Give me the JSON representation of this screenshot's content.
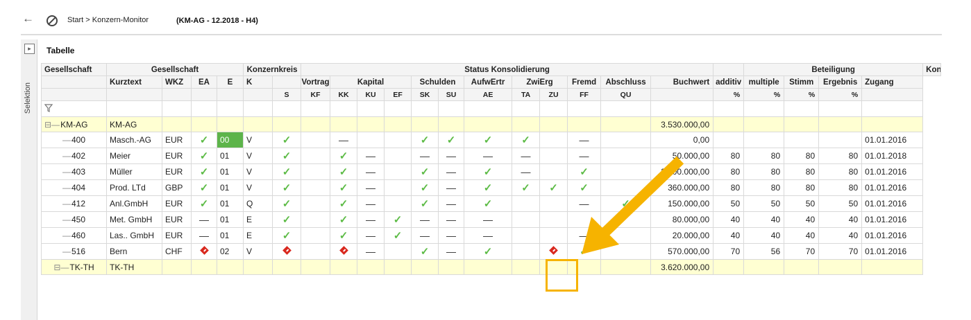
{
  "nav": {
    "breadcrumb": "Start > Konzern-Monitor",
    "context": "(KM-AG - 12.2018 - H4)",
    "back_icon": "arrow-left-icon",
    "block_icon": "no-entry-icon"
  },
  "sidebar": {
    "label": "Selektion",
    "toggle_icon": "expand-right-icon"
  },
  "grid": {
    "title": "Tabelle",
    "header1": {
      "gesellschaft": "Gesellschaft",
      "gesellschaft2": "Gesellschaft",
      "konzernkreis": "Konzernkreis",
      "status": "Status Konsolidierung",
      "beteiligung": "Beteiligung",
      "konzernkreis2": "Konzernkreis"
    },
    "header2": {
      "kurztext": "Kurztext",
      "wkz": "WKZ",
      "ea": "EA",
      "e": "E",
      "k": "K",
      "vortrag": "Vortrag",
      "kapital": "Kapital",
      "schulden": "Schulden",
      "aufwertr": "AufwErtr",
      "zwierg": "ZwiErg",
      "fremd": "Fremd",
      "abschluss": "Abschluss",
      "buchwert": "Buchwert",
      "additiv": "additiv",
      "multiple": "multiple",
      "stimm": "Stimm",
      "ergebnis": "Ergebnis",
      "zugang": "Zugang"
    },
    "header3": {
      "s": "S",
      "kf": "KF",
      "kk": "KK",
      "ku": "KU",
      "ef": "EF",
      "sk": "SK",
      "su": "SU",
      "ae": "AE",
      "ta": "TA",
      "zu": "ZU",
      "ff": "FF",
      "qu": "QU",
      "p1": "%",
      "p2": "%",
      "p3": "%",
      "p4": "%"
    },
    "filter_icon": "filter-icon",
    "groups": [
      {
        "name": "KM-AG",
        "kurztext": "KM-AG",
        "buchwert": "3.530.000,00"
      },
      {
        "name": "TK-TH",
        "kurztext": "TK-TH",
        "buchwert": "3.620.000,00"
      }
    ],
    "rows": [
      {
        "id": "400",
        "kurz": "Masch.-AG",
        "wkz": "EUR",
        "ea": "check",
        "e": "00",
        "k": "V",
        "s": "check",
        "kf": "",
        "kk": "dash",
        "ku": "",
        "ef": "",
        "sk": "check",
        "su": "check",
        "ae": "check",
        "ta": "check",
        "zu": "",
        "ff": "dash",
        "qu": "",
        "buchwert": "0,00",
        "additiv": "",
        "multiple": "",
        "stimm": "",
        "ergebnis": "",
        "zugang": "01.01.2016"
      },
      {
        "id": "402",
        "kurz": "Meier",
        "wkz": "EUR",
        "ea": "check",
        "e": "01",
        "k": "V",
        "s": "check",
        "kf": "",
        "kk": "check",
        "ku": "dash",
        "ef": "",
        "sk": "dash",
        "su": "dash",
        "ae": "dash",
        "ta": "dash",
        "zu": "",
        "ff": "dash",
        "qu": "",
        "buchwert": "50.000,00",
        "additiv": "80",
        "multiple": "80",
        "stimm": "80",
        "ergebnis": "80",
        "zugang": "01.01.2018"
      },
      {
        "id": "403",
        "kurz": "Müller",
        "wkz": "EUR",
        "ea": "check",
        "e": "01",
        "k": "V",
        "s": "check",
        "kf": "",
        "kk": "check",
        "ku": "dash",
        "ef": "",
        "sk": "check",
        "su": "dash",
        "ae": "check",
        "ta": "dash",
        "zu": "",
        "ff": "check",
        "qu": "",
        "buchwert": "2.300.000,00",
        "additiv": "80",
        "multiple": "80",
        "stimm": "80",
        "ergebnis": "80",
        "zugang": "01.01.2016"
      },
      {
        "id": "404",
        "kurz": "Prod. LTd",
        "wkz": "GBP",
        "ea": "check",
        "e": "01",
        "k": "V",
        "s": "check",
        "kf": "",
        "kk": "check",
        "ku": "dash",
        "ef": "",
        "sk": "check",
        "su": "dash",
        "ae": "check",
        "ta": "check",
        "zu": "check",
        "ff": "check",
        "qu": "",
        "buchwert": "360.000,00",
        "additiv": "80",
        "multiple": "80",
        "stimm": "80",
        "ergebnis": "80",
        "zugang": "01.01.2016"
      },
      {
        "id": "412",
        "kurz": "Anl.GmbH",
        "wkz": "EUR",
        "ea": "check",
        "e": "01",
        "k": "Q",
        "s": "check",
        "kf": "",
        "kk": "check",
        "ku": "dash",
        "ef": "",
        "sk": "check",
        "su": "dash",
        "ae": "check",
        "ta": "",
        "zu": "",
        "ff": "dash",
        "qu": "check",
        "buchwert": "150.000,00",
        "additiv": "50",
        "multiple": "50",
        "stimm": "50",
        "ergebnis": "50",
        "zugang": "01.01.2016"
      },
      {
        "id": "450",
        "kurz": "Met. GmbH",
        "wkz": "EUR",
        "ea": "dash",
        "e": "01",
        "k": "E",
        "s": "check",
        "kf": "",
        "kk": "check",
        "ku": "dash",
        "ef": "check",
        "sk": "dash",
        "su": "dash",
        "ae": "dash",
        "ta": "",
        "zu": "",
        "ff": "",
        "qu": "",
        "buchwert": "80.000,00",
        "additiv": "40",
        "multiple": "40",
        "stimm": "40",
        "ergebnis": "40",
        "zugang": "01.01.2016"
      },
      {
        "id": "460",
        "kurz": "Las.. GmbH",
        "wkz": "EUR",
        "ea": "dash",
        "e": "01",
        "k": "E",
        "s": "check",
        "kf": "",
        "kk": "check",
        "ku": "dash",
        "ef": "check",
        "sk": "dash",
        "su": "dash",
        "ae": "dash",
        "ta": "",
        "zu": "",
        "ff": "dash",
        "qu": "",
        "buchwert": "20.000,00",
        "additiv": "40",
        "multiple": "40",
        "stimm": "40",
        "ergebnis": "40",
        "zugang": "01.01.2016"
      },
      {
        "id": "516",
        "kurz": "Bern",
        "wkz": "CHF",
        "ea": "warn",
        "e": "02",
        "k": "V",
        "s": "warn",
        "kf": "",
        "kk": "warn",
        "ku": "dash",
        "ef": "",
        "sk": "check",
        "su": "dash",
        "ae": "check",
        "ta": "",
        "zu": "warn",
        "ff": "check",
        "qu": "",
        "buchwert": "570.000,00",
        "additiv": "70",
        "multiple": "56",
        "stimm": "70",
        "ergebnis": "70",
        "zugang": "01.01.2016"
      }
    ]
  },
  "colors": {
    "check": "#5dbb46",
    "warn": "#d9281e",
    "group_bg": "#ffffd2",
    "highlight": "#f6b300"
  }
}
